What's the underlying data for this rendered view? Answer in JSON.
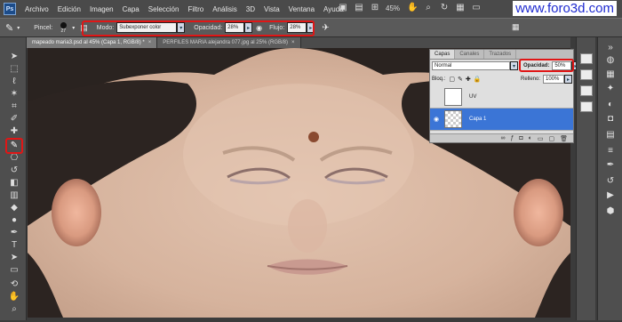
{
  "app": {
    "logo": "Ps",
    "menu": [
      "Archivo",
      "Edición",
      "Imagen",
      "Capa",
      "Selección",
      "Filtro",
      "Análisis",
      "3D",
      "Vista",
      "Ventana",
      "Ayuda"
    ],
    "zoom": "45%",
    "watermark": "www.foro3d.com"
  },
  "options_bar": {
    "tool_label": "Pincel:",
    "brush_size": "27",
    "mode_label": "Modo:",
    "mode_value": "Subexponer color",
    "opacity_label": "Opacidad:",
    "opacity_value": "28%",
    "flow_label": "Flujo:",
    "flow_value": "28%"
  },
  "tabs": [
    {
      "label": "mapeado maria3.psd al 45% (Capa 1, RGB/8) *",
      "active": true
    },
    {
      "label": "PERFILES MARIA alejandra 077.jpg al 25% (RGB/8)",
      "active": false
    }
  ],
  "layers_panel": {
    "tabs": [
      "Capas",
      "Canales",
      "Trazados"
    ],
    "blend_mode": "Normal",
    "opacity_label": "Opacidad:",
    "opacity_value": "50%",
    "lock_label": "Bloq.:",
    "fill_label": "Relleno:",
    "fill_value": "100%",
    "layers": [
      {
        "name": "UV",
        "visible": false,
        "selected": false
      },
      {
        "name": "Capa 1",
        "visible": true,
        "selected": true
      }
    ],
    "footer_icons": [
      "link-icon",
      "fx-icon",
      "mask-icon",
      "adjustment-icon",
      "group-icon",
      "new-layer-icon",
      "trash-icon"
    ]
  },
  "colors": {
    "highlight_red": "#e01616",
    "selected_layer": "#3b75d6",
    "watermark_blue": "#1f2bd0"
  }
}
